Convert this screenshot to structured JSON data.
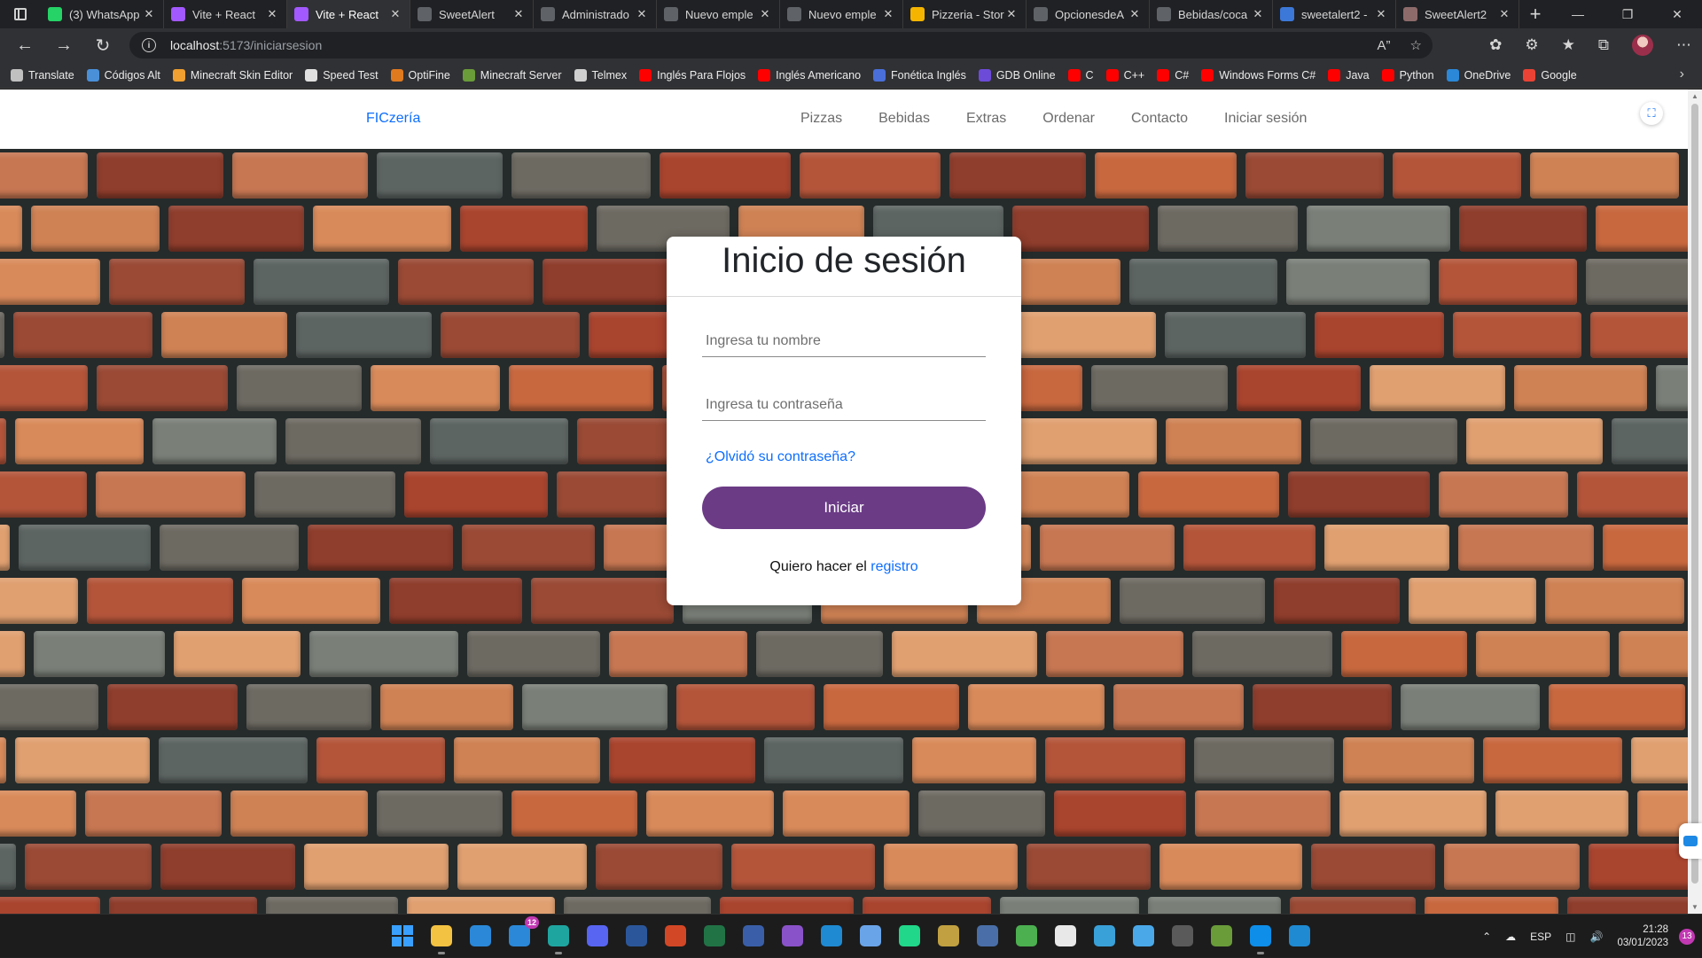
{
  "browser": {
    "tabs": [
      {
        "label": "(3) WhatsApp",
        "icon": "whatsapp-icon",
        "color": "#25d366",
        "active": false
      },
      {
        "label": "Vite + React",
        "icon": "vite-icon",
        "color": "#a259ff",
        "active": false
      },
      {
        "label": "Vite + React",
        "icon": "vite-icon",
        "color": "#a259ff",
        "active": true
      },
      {
        "label": "SweetAlert",
        "icon": "page-icon",
        "color": "#5f6368",
        "active": false
      },
      {
        "label": "Administrado",
        "icon": "page-icon",
        "color": "#5f6368",
        "active": false
      },
      {
        "label": "Nuevo emple",
        "icon": "page-icon",
        "color": "#5f6368",
        "active": false
      },
      {
        "label": "Nuevo emple",
        "icon": "page-icon",
        "color": "#5f6368",
        "active": false
      },
      {
        "label": "Pizzeria - Stor",
        "icon": "pizza-icon",
        "color": "#f4b400",
        "active": false
      },
      {
        "label": "OpcionesdeA",
        "icon": "page-icon",
        "color": "#5f6368",
        "active": false
      },
      {
        "label": "Bebidas/coca",
        "icon": "page-icon",
        "color": "#5f6368",
        "active": false
      },
      {
        "label": "sweetalert2 -",
        "icon": "search-icon",
        "color": "#3c78d8",
        "active": false
      },
      {
        "label": "SweetAlert2",
        "icon": "sweetalert-icon",
        "color": "#8e6b6b",
        "active": false
      }
    ],
    "url": {
      "host": "localhost",
      "path": ":5173/iniciarsesion"
    },
    "bookmarks": [
      {
        "label": "Translate",
        "color": "#c0c0c0"
      },
      {
        "label": "Códigos Alt",
        "color": "#4a90d9"
      },
      {
        "label": "Minecraft Skin Editor",
        "color": "#f0a030"
      },
      {
        "label": "Speed Test",
        "color": "#e0e0e0"
      },
      {
        "label": "OptiFine",
        "color": "#e07a1f"
      },
      {
        "label": "Minecraft Server",
        "color": "#6a9c3a"
      },
      {
        "label": "Telmex",
        "color": "#d0d0d0"
      },
      {
        "label": "Inglés Para Flojos",
        "color": "#ff0000"
      },
      {
        "label": "Inglés Americano",
        "color": "#ff0000"
      },
      {
        "label": "Fonética Inglés",
        "color": "#4a6fd9"
      },
      {
        "label": "GDB Online",
        "color": "#6c4bd9"
      },
      {
        "label": "C",
        "color": "#ff0000"
      },
      {
        "label": "C++",
        "color": "#ff0000"
      },
      {
        "label": "C#",
        "color": "#ff0000"
      },
      {
        "label": "Windows Forms C#",
        "color": "#ff0000"
      },
      {
        "label": "Java",
        "color": "#ff0000"
      },
      {
        "label": "Python",
        "color": "#ff0000"
      },
      {
        "label": "OneDrive",
        "color": "#2b88d8"
      },
      {
        "label": "Google",
        "color": "#ea4335"
      }
    ]
  },
  "site": {
    "brand": "FICzería",
    "nav": [
      "Pizzas",
      "Bebidas",
      "Extras",
      "Ordenar",
      "Contacto",
      "Iniciar sesión"
    ],
    "accent_color": "#0d6efd"
  },
  "login": {
    "title": "Inicio de sesión",
    "name_placeholder": "Ingresa tu nombre",
    "password_placeholder": "Ingresa tu contraseña",
    "forgot_link": "¿Olvidó su contraseña?",
    "submit_label": "Iniciar",
    "register_prefix": "Quiero hacer el",
    "register_link": "registro",
    "button_color": "#6b3b86"
  },
  "taskbar": {
    "apps": [
      {
        "name": "start-icon",
        "color": "#1c1c1c"
      },
      {
        "name": "file-explorer-icon",
        "color": "#f4c242"
      },
      {
        "name": "store-icon",
        "color": "#2b88d8"
      },
      {
        "name": "mail-icon",
        "color": "#2b88d8",
        "badge": "12"
      },
      {
        "name": "edge-icon",
        "color": "#1fa5a0"
      },
      {
        "name": "discord-icon",
        "color": "#5865f2"
      },
      {
        "name": "word-icon",
        "color": "#2b579a"
      },
      {
        "name": "powerpoint-icon",
        "color": "#d24726"
      },
      {
        "name": "excel-icon",
        "color": "#217346"
      },
      {
        "name": "devc-icon",
        "color": "#3a5fa8"
      },
      {
        "name": "visual-studio-icon",
        "color": "#8a52c8"
      },
      {
        "name": "vscode-icon",
        "color": "#1f8ad2"
      },
      {
        "name": "box-icon",
        "color": "#6aa4e8"
      },
      {
        "name": "pycharm-icon",
        "color": "#21d789"
      },
      {
        "name": "tool-icon",
        "color": "#c0a040"
      },
      {
        "name": "sql-icon",
        "color": "#4a6fa8"
      },
      {
        "name": "chrome-icon",
        "color": "#4caf50"
      },
      {
        "name": "notepad-icon",
        "color": "#e8e8e8"
      },
      {
        "name": "earth-icon",
        "color": "#3aa0d8"
      },
      {
        "name": "notes-icon",
        "color": "#4aa8e8"
      },
      {
        "name": "calculator-icon",
        "color": "#5a5a5a"
      },
      {
        "name": "minecraft-icon",
        "color": "#6a9c3a"
      },
      {
        "name": "teamviewer-icon",
        "color": "#0e8ee9"
      },
      {
        "name": "edge-dev-icon",
        "color": "#1f8ad2"
      }
    ],
    "language": "ESP",
    "time": "21:28",
    "date": "03/01/2023",
    "notifications": "13"
  }
}
